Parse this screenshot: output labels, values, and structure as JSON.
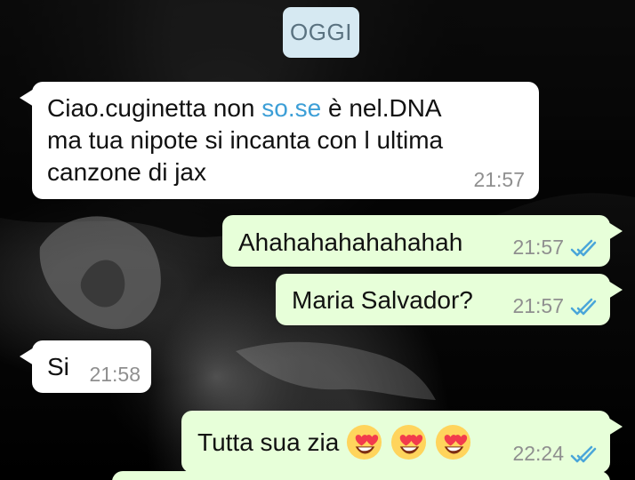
{
  "chat": {
    "date_chip": "OGGI",
    "messages": [
      {
        "direction": "in",
        "text_before_link": "Ciao.cuginetta non ",
        "link_text": "so.se",
        "text_after_link": " è nel.DNA",
        "line2": "ma tua nipote si incanta con l ultima",
        "line3": "canzone di jax",
        "time": "21:57"
      },
      {
        "direction": "out",
        "text": "Ahahahahahahahah",
        "time": "21:57",
        "status": "read"
      },
      {
        "direction": "out",
        "text": "Maria Salvador?",
        "time": "21:57",
        "status": "read"
      },
      {
        "direction": "in",
        "text": "Si",
        "time": "21:58"
      },
      {
        "direction": "out",
        "text": "Tutta sua zia",
        "time": "22:24",
        "status": "read",
        "emojis": [
          "heart-eyes-emoji",
          "heart-eyes-emoji",
          "heart-eyes-emoji"
        ]
      }
    ]
  },
  "colors": {
    "incoming_bubble": "#ffffff",
    "outgoing_bubble": "#e7ffd9",
    "date_chip": "#d6e9f2",
    "link": "#3d9fd7",
    "read_ticks": "#4aa6d9",
    "meta_text": "#8f8f8f"
  }
}
